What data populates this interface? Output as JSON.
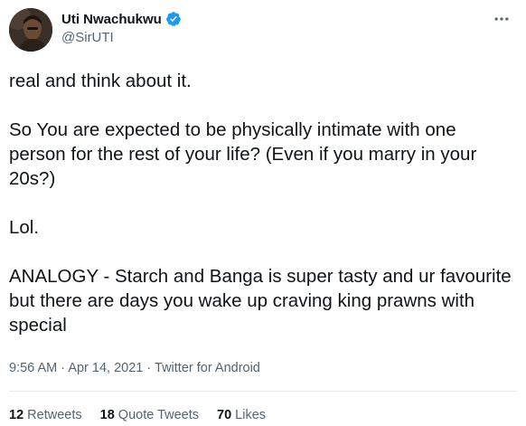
{
  "author": {
    "display_name": "Uti Nwachukwu",
    "handle": "@SirUTI",
    "verified_icon": "verified-badge-icon"
  },
  "more_icon": "more-options-icon",
  "tweet": {
    "paragraphs": [
      "real and think about it.",
      "So You are expected to be physically intimate with one person for the rest of your life? (Even if you marry in your 20s?)",
      "Lol.",
      "ANALOGY - Starch and Banga is super tasty and ur favourite but there are days you wake up craving king prawns with special"
    ]
  },
  "meta": {
    "time": "9:56 AM",
    "separator": "·",
    "date": "Apr 14, 2021",
    "client": "Twitter for Android"
  },
  "stats": {
    "retweets_count": "12",
    "retweets_label": "Retweets",
    "quotes_count": "18",
    "quotes_label": "Quote Tweets",
    "likes_count": "70",
    "likes_label": "Likes"
  },
  "colors": {
    "text": "#0f1419",
    "secondary": "#536471",
    "verified": "#1d9bf0",
    "divider": "#e6ecf0"
  }
}
